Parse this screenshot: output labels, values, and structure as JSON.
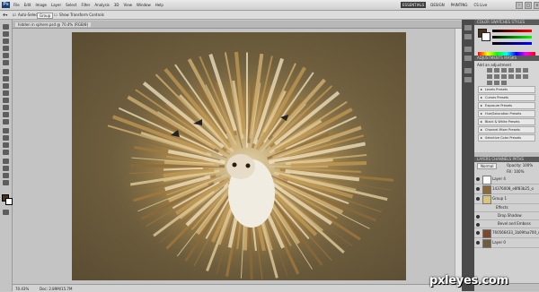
{
  "app": {
    "name": "Ps"
  },
  "menu": [
    "File",
    "Edit",
    "Image",
    "Layer",
    "Select",
    "Filter",
    "Analysis",
    "3D",
    "View",
    "Window",
    "Help"
  ],
  "workspaces": [
    "ESSENTIALS",
    "DESIGN",
    "PAINTING"
  ],
  "search_placeholder": "CS Live",
  "options": {
    "auto_select_label": "Auto-Select:",
    "auto_select_value": "Group",
    "transform_label": "Show Transform Controls"
  },
  "document": {
    "tab_title": "hidden in sphere.psd @ 70.4% (RGB/8)",
    "zoom": "70.43%",
    "doc_size": "Doc: 2.89M/15.7M"
  },
  "panels": {
    "color_tab": "COLOR",
    "swatches_tab": "SWATCHES",
    "styles_tab": "STYLES",
    "adjustments_tab": "ADJUSTMENTS",
    "masks_tab": "MASKS",
    "adjustment_title": "Add an adjustment",
    "presets": [
      "Levels Presets",
      "Curves Presets",
      "Exposure Presets",
      "Hue/Saturation Presets",
      "Black & White Presets",
      "Channel Mixer Presets",
      "Selective Color Presets"
    ],
    "layers_tab": "LAYERS",
    "channels_tab": "CHANNELS",
    "paths_tab": "PATHS",
    "blend_mode": "Normal",
    "opacity": "Opacity: 100%",
    "fill": "Fill: 100%"
  },
  "layers": [
    {
      "name": "Layer 4",
      "type": "pixel"
    },
    {
      "name": "14376008_e8f83b25_o",
      "type": "pixel"
    },
    {
      "name": "Group 1",
      "type": "group"
    },
    {
      "name": "Effects",
      "type": "fx"
    },
    {
      "name": "Drop Shadow",
      "type": "fx"
    },
    {
      "name": "Bevel and Emboss",
      "type": "fx"
    },
    {
      "name": "760566433_1b09faa700_o",
      "type": "pixel"
    },
    {
      "name": "Layer 0",
      "type": "pixel"
    }
  ],
  "watermark": "pxleyes.com",
  "colors": {
    "accent": "#7b9bd4",
    "canvas_bg": "#6e5e3e"
  }
}
